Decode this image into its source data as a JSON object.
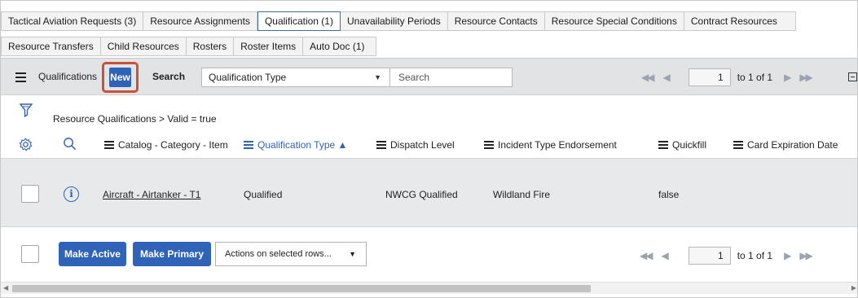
{
  "tabs_row1": [
    {
      "label": "Tactical Aviation Requests (3)",
      "active": false
    },
    {
      "label": "Resource Assignments",
      "active": false
    },
    {
      "label": "Qualification (1)",
      "active": true
    },
    {
      "label": "Unavailability Periods",
      "active": false
    },
    {
      "label": "Resource Contacts",
      "active": false
    },
    {
      "label": "Resource Special Conditions",
      "active": false
    },
    {
      "label": "Contract Resources",
      "active": false
    }
  ],
  "tabs_row2": [
    {
      "label": "Resource Transfers",
      "active": false
    },
    {
      "label": "Child Resources",
      "active": false
    },
    {
      "label": "Rosters",
      "active": false
    },
    {
      "label": "Roster Items",
      "active": false
    },
    {
      "label": "Auto Doc (1)",
      "active": false
    }
  ],
  "toolbar": {
    "list_title": "Qualifications",
    "new_label": "New",
    "search_label": "Search",
    "search_field": "Qualification Type",
    "search_placeholder": "Search",
    "page_current": "1",
    "page_range": "to 1 of 1"
  },
  "filter": {
    "breadcrumb": "Resource Qualifications > Valid = true"
  },
  "columns": [
    {
      "label": "Catalog - Category - Item",
      "sorted": false
    },
    {
      "label": "Qualification Type ▲",
      "sorted": true
    },
    {
      "label": "Dispatch Level",
      "sorted": false
    },
    {
      "label": "Incident Type Endorsement",
      "sorted": false
    },
    {
      "label": "Quickfill",
      "sorted": false
    },
    {
      "label": "Card Expiration Date",
      "sorted": false
    }
  ],
  "rows": [
    {
      "catalog_item": "Aircraft - Airtanker - T1",
      "qualification_type": "Qualified",
      "dispatch_level": "NWCG Qualified",
      "incident_type_endorsement": "Wildland Fire",
      "quickfill": "false",
      "card_expiration_date": ""
    }
  ],
  "footer": {
    "make_active_label": "Make Active",
    "make_primary_label": "Make Primary",
    "actions_label": "Actions on selected rows...",
    "page_current": "1",
    "page_range": "to 1 of 1"
  },
  "colors": {
    "primary_button": "#2e63b7",
    "highlight_outline": "#c9533a",
    "toolbar_bg": "#e2e3e5"
  }
}
